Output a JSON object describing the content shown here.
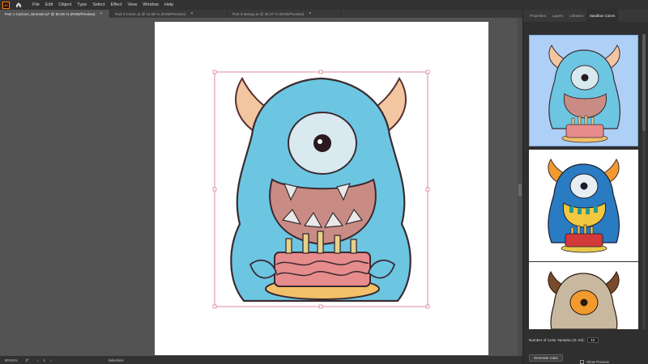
{
  "app": {
    "logo_text": "Ai"
  },
  "menu": [
    "File",
    "Edit",
    "Object",
    "Type",
    "Select",
    "Effect",
    "View",
    "Window",
    "Help"
  ],
  "tabs": [
    {
      "label": "Part 1 Cartoon_Monster.ai* @ 50.91 % (RGB/Preview)",
      "close": "×"
    },
    {
      "label": "Part 2 Comic.ai @ 12.86 % (RGB/Preview)",
      "close": "×"
    },
    {
      "label": "Part 3 Manga.ai @ 35.37 % (RGB/Preview)",
      "close": "×"
    }
  ],
  "statusbar": {
    "zoom": "50.91%",
    "rotation": "0°",
    "artboard": "1",
    "tool": "Selection"
  },
  "panel": {
    "tabs": [
      "Properties",
      "Layers",
      "Libraries",
      "Sandbox Colors"
    ],
    "variations_label": "Number of Color Variation (0~10):",
    "variations_value": "10",
    "generate_label": "Generate Color",
    "preview_label": "Show Preview"
  },
  "colors": {
    "fur": "#6cc6e2",
    "fur_dark": "#5ab4d0",
    "horn": "#f2c6a0",
    "eye_white": "#d8e9f0",
    "mouth": "#c98c84",
    "cake": "#e68c8c",
    "cake_plate": "#f2c068",
    "candle": "#e8d08a",
    "var2_fur": "#2a7cc2",
    "var2_horn": "#f29a2e",
    "var3_fur": "#c8b8a0",
    "var3_horn": "#7a4a2a",
    "var3_eye": "#f29a2e"
  }
}
